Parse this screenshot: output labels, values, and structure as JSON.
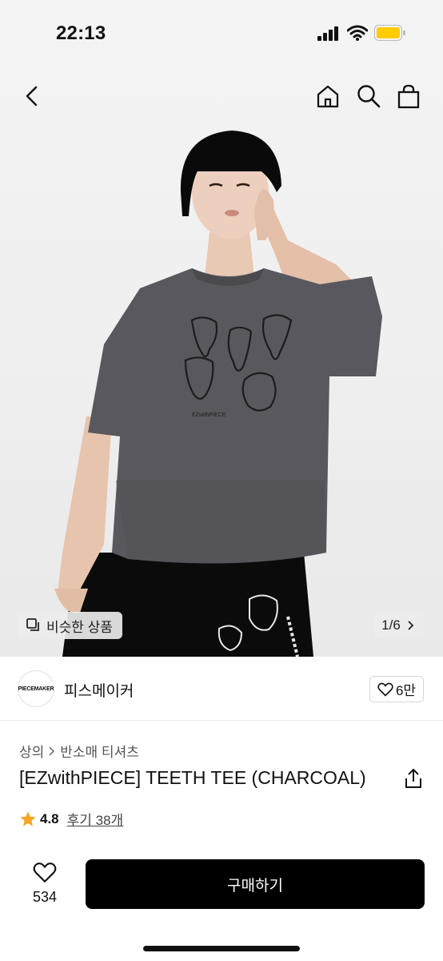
{
  "status_bar": {
    "time": "22:13",
    "icons": [
      "cellular-signal-icon",
      "wifi-icon",
      "battery-icon"
    ],
    "battery_color": "#ffcc00"
  },
  "nav": {
    "icons": [
      "back-chevron-icon",
      "home-icon",
      "search-icon",
      "shopping-bag-icon"
    ]
  },
  "gallery": {
    "similar_label": "비슷한 상품",
    "counter": "1/6",
    "print_text": "EZwithPIECE"
  },
  "brand": {
    "logo_text": "PIECEMAKER",
    "name": "피스메이커",
    "likes": "6만"
  },
  "product": {
    "breadcrumb": [
      "상의",
      "반소매 티셔츠"
    ],
    "title": "[EZwithPIECE] TEETH TEE (CHARCOAL)",
    "rating": "4.8",
    "reviews": "후기 38개",
    "star_color": "#f5a623"
  },
  "bottom_bar": {
    "wish_count": "534",
    "buy_label": "구매하기"
  }
}
